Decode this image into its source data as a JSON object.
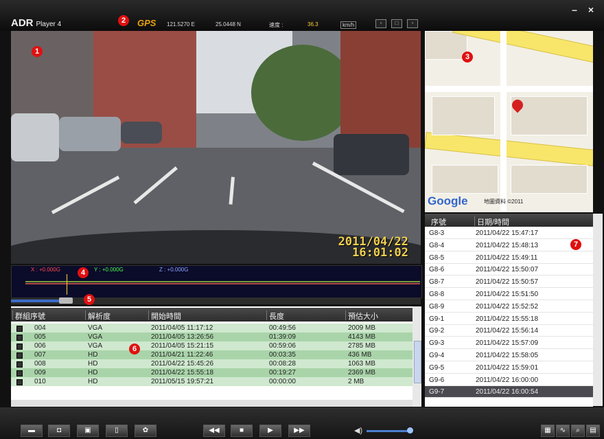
{
  "app": {
    "brand": "ADR",
    "name": "Player 4"
  },
  "hud": {
    "lon": "121.5270 E",
    "lat": "25.0448 N",
    "speed_label": "速度 :",
    "speed": "36.3",
    "unit": "km/h"
  },
  "badges": [
    "1",
    "2",
    "3",
    "4",
    "5",
    "6",
    "7"
  ],
  "video": {
    "date": "2011/04/22",
    "time": "16:01:02"
  },
  "gsensor": {
    "x": "X : +0.000G",
    "y": "Y : +0.000G",
    "z": "Z : +0.000G"
  },
  "map": {
    "logo": "Google",
    "copyright": "地圖資料 ©2011"
  },
  "events": {
    "headers": [
      "群組序號",
      "解析度",
      "開始時間",
      "長度",
      "預估大小"
    ],
    "rows": [
      {
        "id": "004",
        "res": "VGA",
        "start": "2011/04/05 11:17:12",
        "len": "00:49:56",
        "size": "2009 MB"
      },
      {
        "id": "005",
        "res": "VGA",
        "start": "2011/04/05 13:26:56",
        "len": "01:39:09",
        "size": "4143 MB"
      },
      {
        "id": "006",
        "res": "VGA",
        "start": "2011/04/05 15:21:15",
        "len": "00:59:06",
        "size": "2785 MB"
      },
      {
        "id": "007",
        "res": "HD",
        "start": "2011/04/21 11:22:46",
        "len": "00:03:35",
        "size": "436 MB"
      },
      {
        "id": "008",
        "res": "HD",
        "start": "2011/04/22 15:45:26",
        "len": "00:08:28",
        "size": "1063 MB"
      },
      {
        "id": "009",
        "res": "HD",
        "start": "2011/04/22 15:55:18",
        "len": "00:19:27",
        "size": "2369 MB"
      },
      {
        "id": "010",
        "res": "HD",
        "start": "2011/05/15 19:57:21",
        "len": "00:00:00",
        "size": "2 MB"
      }
    ]
  },
  "trips": {
    "headers": [
      "序號",
      "日期/時間"
    ],
    "rows": [
      {
        "id": "G8-3",
        "dt": "2011/04/22 15:47:17"
      },
      {
        "id": "G8-4",
        "dt": "2011/04/22 15:48:13"
      },
      {
        "id": "G8-5",
        "dt": "2011/04/22 15:49:11"
      },
      {
        "id": "G8-6",
        "dt": "2011/04/22 15:50:07"
      },
      {
        "id": "G8-7",
        "dt": "2011/04/22 15:50:57"
      },
      {
        "id": "G8-8",
        "dt": "2011/04/22 15:51:50"
      },
      {
        "id": "G8-9",
        "dt": "2011/04/22 15:52:52"
      },
      {
        "id": "G9-1",
        "dt": "2011/04/22 15:55:18"
      },
      {
        "id": "G9-2",
        "dt": "2011/04/22 15:56:14"
      },
      {
        "id": "G9-3",
        "dt": "2011/04/22 15:57:09"
      },
      {
        "id": "G9-4",
        "dt": "2011/04/22 15:58:05"
      },
      {
        "id": "G9-5",
        "dt": "2011/04/22 15:59:01"
      },
      {
        "id": "G9-6",
        "dt": "2011/04/22 16:00:00"
      },
      {
        "id": "G9-7",
        "dt": "2011/04/22 16:00:54"
      }
    ]
  },
  "toolbar": {
    "icons": [
      "folder-icon",
      "camera-icon",
      "save-icon",
      "trash-icon",
      "settings-icon",
      "rewind-icon",
      "stop-icon",
      "play-icon",
      "fast-forward-icon",
      "volume-icon",
      "map-icon",
      "chart-icon",
      "search-icon",
      "export-icon"
    ]
  }
}
